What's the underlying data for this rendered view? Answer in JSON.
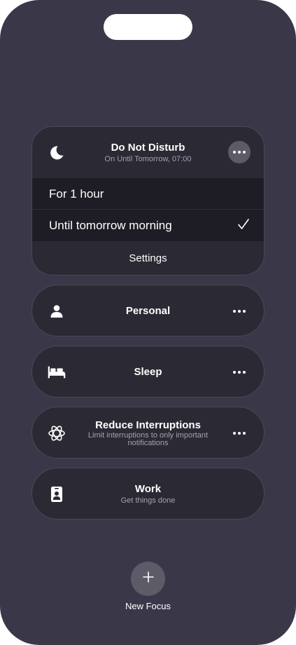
{
  "focus_modes": {
    "do_not_disturb": {
      "title": "Do Not Disturb",
      "subtitle": "On Until Tomorrow, 07:00",
      "icon": "moon-icon",
      "options": [
        {
          "label": "For 1 hour",
          "selected": false
        },
        {
          "label": "Until tomorrow morning",
          "selected": true
        }
      ],
      "settings_label": "Settings"
    },
    "personal": {
      "title": "Personal",
      "icon": "person-icon"
    },
    "sleep": {
      "title": "Sleep",
      "icon": "bed-icon"
    },
    "reduce_interruptions": {
      "title": "Reduce Interruptions",
      "subtitle": "Limit interruptions to only important notifications",
      "icon": "atom-icon"
    },
    "work": {
      "title": "Work",
      "subtitle": "Get things done",
      "icon": "id-badge-icon"
    }
  },
  "new_focus": {
    "label": "New Focus",
    "icon": "plus-icon"
  },
  "colors": {
    "background": "#3a3848",
    "card": "#2b2a34",
    "option_row": "#1e1d25",
    "button": "#5d5b68"
  }
}
